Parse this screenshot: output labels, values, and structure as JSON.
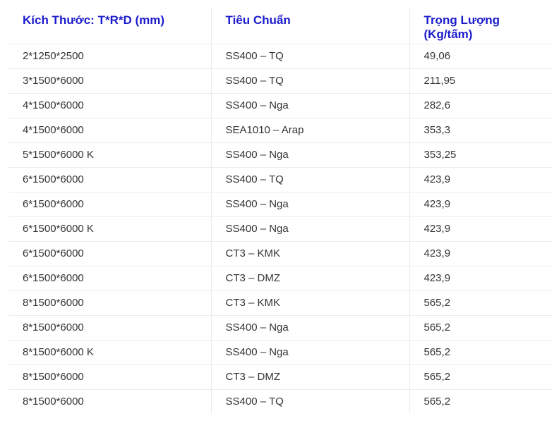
{
  "table": {
    "headers": [
      "Kích Thước: T*R*D (mm)",
      "Tiêu Chuẩn",
      "Trọng Lượng (Kg/tấm)"
    ],
    "rows": [
      [
        "2*1250*2500",
        "SS400 – TQ",
        "49,06"
      ],
      [
        "3*1500*6000",
        "SS400 – TQ",
        "211,95"
      ],
      [
        "4*1500*6000",
        "SS400 – Nga",
        "282,6"
      ],
      [
        "4*1500*6000",
        "SEA1010 – Arap",
        "353,3"
      ],
      [
        "5*1500*6000 K",
        "SS400 – Nga",
        "353,25"
      ],
      [
        "6*1500*6000",
        "SS400 – TQ",
        "423,9"
      ],
      [
        "6*1500*6000",
        "SS400 – Nga",
        "423,9"
      ],
      [
        "6*1500*6000 K",
        "SS400 – Nga",
        "423,9"
      ],
      [
        "6*1500*6000",
        "CT3 – KMK",
        "423,9"
      ],
      [
        "6*1500*6000",
        "CT3 – DMZ",
        "423,9"
      ],
      [
        "8*1500*6000",
        "CT3 – KMK",
        "565,2"
      ],
      [
        "8*1500*6000",
        "SS400 – Nga",
        "565,2"
      ],
      [
        "8*1500*6000 K",
        "SS400 – Nga",
        "565,2"
      ],
      [
        "8*1500*6000",
        "CT3 – DMZ",
        "565,2"
      ],
      [
        "8*1500*6000",
        "SS400 – TQ",
        "565,2"
      ]
    ],
    "header_color": "#1a1acd",
    "text_color": "#333333",
    "border_color": "#ececec"
  }
}
